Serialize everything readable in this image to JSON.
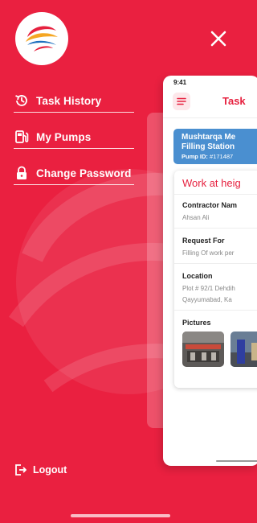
{
  "drawer": {
    "menu": [
      {
        "label": "Task History",
        "icon": "history-icon"
      },
      {
        "label": "My Pumps",
        "icon": "fuel-pump-icon"
      },
      {
        "label": "Change Password",
        "icon": "lock-icon"
      }
    ],
    "logout_label": "Logout"
  },
  "preview": {
    "status_time": "9:41",
    "screen_title": "Task",
    "station_name_line1": "Mushtarqa Me",
    "station_name_line2": "Filling Station",
    "pump_id_label": "Pump ID:",
    "pump_id_value": "#171487",
    "card_title": "Work at heig",
    "fields": [
      {
        "label": "Contractor Nam",
        "value": "Ahsan Ali"
      },
      {
        "label": "Request For",
        "value": "Filling Of work per"
      },
      {
        "label": "Location",
        "value": "Plot # 92/1 Dehdih",
        "value2": "Qayyumabad, Ka"
      }
    ],
    "pictures_label": "Pictures"
  },
  "colors": {
    "background": "#ea2040",
    "accent": "#e6213f",
    "station_card": "#4a8fd0"
  }
}
